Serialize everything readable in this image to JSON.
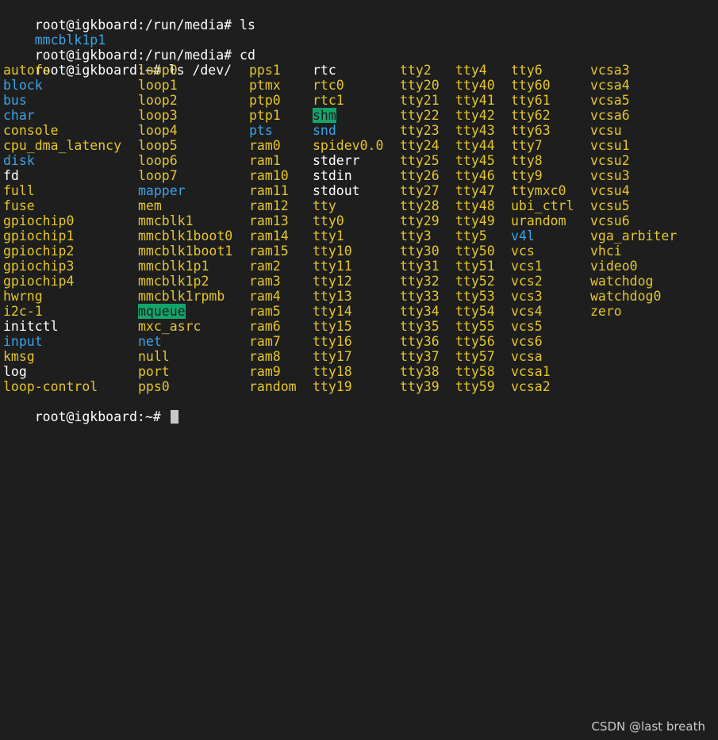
{
  "terminal": {
    "history": [
      {
        "prompt": "root@igkboard:/run/media# ",
        "command": "ls"
      }
    ],
    "media_listing": "mmcblk1p1",
    "history2": [
      {
        "prompt": "root@igkboard:/run/media# ",
        "command": "cd"
      },
      {
        "prompt": "root@igkboard:~# ",
        "command": "ls /dev/"
      }
    ],
    "columns": [
      [
        {
          "t": "autofs",
          "k": "dev"
        },
        {
          "t": "block",
          "k": "dir"
        },
        {
          "t": "bus",
          "k": "dir"
        },
        {
          "t": "char",
          "k": "dir"
        },
        {
          "t": "console",
          "k": "dev"
        },
        {
          "t": "cpu_dma_latency",
          "k": "dev"
        },
        {
          "t": "disk",
          "k": "dir"
        },
        {
          "t": "fd",
          "k": "link"
        },
        {
          "t": "full",
          "k": "dev"
        },
        {
          "t": "fuse",
          "k": "dev"
        },
        {
          "t": "gpiochip0",
          "k": "dev"
        },
        {
          "t": "gpiochip1",
          "k": "dev"
        },
        {
          "t": "gpiochip2",
          "k": "dev"
        },
        {
          "t": "gpiochip3",
          "k": "dev"
        },
        {
          "t": "gpiochip4",
          "k": "dev"
        },
        {
          "t": "hwrng",
          "k": "dev"
        },
        {
          "t": "i2c-1",
          "k": "dev"
        },
        {
          "t": "initctl",
          "k": "link"
        },
        {
          "t": "input",
          "k": "dir"
        },
        {
          "t": "kmsg",
          "k": "dev"
        },
        {
          "t": "log",
          "k": "link"
        },
        {
          "t": "loop-control",
          "k": "dev"
        }
      ],
      [
        {
          "t": "loop0",
          "k": "dev"
        },
        {
          "t": "loop1",
          "k": "dev"
        },
        {
          "t": "loop2",
          "k": "dev"
        },
        {
          "t": "loop3",
          "k": "dev"
        },
        {
          "t": "loop4",
          "k": "dev"
        },
        {
          "t": "loop5",
          "k": "dev"
        },
        {
          "t": "loop6",
          "k": "dev"
        },
        {
          "t": "loop7",
          "k": "dev"
        },
        {
          "t": "mapper",
          "k": "dir"
        },
        {
          "t": "mem",
          "k": "dev"
        },
        {
          "t": "mmcblk1",
          "k": "dev"
        },
        {
          "t": "mmcblk1boot0",
          "k": "dev"
        },
        {
          "t": "mmcblk1boot1",
          "k": "dev"
        },
        {
          "t": "mmcblk1p1",
          "k": "dev"
        },
        {
          "t": "mmcblk1p2",
          "k": "dev"
        },
        {
          "t": "mmcblk1rpmb",
          "k": "dev"
        },
        {
          "t": "mqueue",
          "k": "sticky"
        },
        {
          "t": "mxc_asrc",
          "k": "dev"
        },
        {
          "t": "net",
          "k": "dir"
        },
        {
          "t": "null",
          "k": "dev"
        },
        {
          "t": "port",
          "k": "dev"
        },
        {
          "t": "pps0",
          "k": "dev"
        }
      ],
      [
        {
          "t": "pps1",
          "k": "dev"
        },
        {
          "t": "ptmx",
          "k": "dev"
        },
        {
          "t": "ptp0",
          "k": "dev"
        },
        {
          "t": "ptp1",
          "k": "dev"
        },
        {
          "t": "pts",
          "k": "dir"
        },
        {
          "t": "ram0",
          "k": "dev"
        },
        {
          "t": "ram1",
          "k": "dev"
        },
        {
          "t": "ram10",
          "k": "dev"
        },
        {
          "t": "ram11",
          "k": "dev"
        },
        {
          "t": "ram12",
          "k": "dev"
        },
        {
          "t": "ram13",
          "k": "dev"
        },
        {
          "t": "ram14",
          "k": "dev"
        },
        {
          "t": "ram15",
          "k": "dev"
        },
        {
          "t": "ram2",
          "k": "dev"
        },
        {
          "t": "ram3",
          "k": "dev"
        },
        {
          "t": "ram4",
          "k": "dev"
        },
        {
          "t": "ram5",
          "k": "dev"
        },
        {
          "t": "ram6",
          "k": "dev"
        },
        {
          "t": "ram7",
          "k": "dev"
        },
        {
          "t": "ram8",
          "k": "dev"
        },
        {
          "t": "ram9",
          "k": "dev"
        },
        {
          "t": "random",
          "k": "dev"
        }
      ],
      [
        {
          "t": "rtc",
          "k": "link"
        },
        {
          "t": "rtc0",
          "k": "dev"
        },
        {
          "t": "rtc1",
          "k": "dev"
        },
        {
          "t": "shm",
          "k": "sticky"
        },
        {
          "t": "snd",
          "k": "dir"
        },
        {
          "t": "spidev0.0",
          "k": "dev"
        },
        {
          "t": "stderr",
          "k": "link"
        },
        {
          "t": "stdin",
          "k": "link"
        },
        {
          "t": "stdout",
          "k": "link"
        },
        {
          "t": "tty",
          "k": "dev"
        },
        {
          "t": "tty0",
          "k": "dev"
        },
        {
          "t": "tty1",
          "k": "dev"
        },
        {
          "t": "tty10",
          "k": "dev"
        },
        {
          "t": "tty11",
          "k": "dev"
        },
        {
          "t": "tty12",
          "k": "dev"
        },
        {
          "t": "tty13",
          "k": "dev"
        },
        {
          "t": "tty14",
          "k": "dev"
        },
        {
          "t": "tty15",
          "k": "dev"
        },
        {
          "t": "tty16",
          "k": "dev"
        },
        {
          "t": "tty17",
          "k": "dev"
        },
        {
          "t": "tty18",
          "k": "dev"
        },
        {
          "t": "tty19",
          "k": "dev"
        }
      ],
      [
        {
          "t": "tty2",
          "k": "dev"
        },
        {
          "t": "tty20",
          "k": "dev"
        },
        {
          "t": "tty21",
          "k": "dev"
        },
        {
          "t": "tty22",
          "k": "dev"
        },
        {
          "t": "tty23",
          "k": "dev"
        },
        {
          "t": "tty24",
          "k": "dev"
        },
        {
          "t": "tty25",
          "k": "dev"
        },
        {
          "t": "tty26",
          "k": "dev"
        },
        {
          "t": "tty27",
          "k": "dev"
        },
        {
          "t": "tty28",
          "k": "dev"
        },
        {
          "t": "tty29",
          "k": "dev"
        },
        {
          "t": "tty3",
          "k": "dev"
        },
        {
          "t": "tty30",
          "k": "dev"
        },
        {
          "t": "tty31",
          "k": "dev"
        },
        {
          "t": "tty32",
          "k": "dev"
        },
        {
          "t": "tty33",
          "k": "dev"
        },
        {
          "t": "tty34",
          "k": "dev"
        },
        {
          "t": "tty35",
          "k": "dev"
        },
        {
          "t": "tty36",
          "k": "dev"
        },
        {
          "t": "tty37",
          "k": "dev"
        },
        {
          "t": "tty38",
          "k": "dev"
        },
        {
          "t": "tty39",
          "k": "dev"
        }
      ],
      [
        {
          "t": "tty4",
          "k": "dev"
        },
        {
          "t": "tty40",
          "k": "dev"
        },
        {
          "t": "tty41",
          "k": "dev"
        },
        {
          "t": "tty42",
          "k": "dev"
        },
        {
          "t": "tty43",
          "k": "dev"
        },
        {
          "t": "tty44",
          "k": "dev"
        },
        {
          "t": "tty45",
          "k": "dev"
        },
        {
          "t": "tty46",
          "k": "dev"
        },
        {
          "t": "tty47",
          "k": "dev"
        },
        {
          "t": "tty48",
          "k": "dev"
        },
        {
          "t": "tty49",
          "k": "dev"
        },
        {
          "t": "tty5",
          "k": "dev"
        },
        {
          "t": "tty50",
          "k": "dev"
        },
        {
          "t": "tty51",
          "k": "dev"
        },
        {
          "t": "tty52",
          "k": "dev"
        },
        {
          "t": "tty53",
          "k": "dev"
        },
        {
          "t": "tty54",
          "k": "dev"
        },
        {
          "t": "tty55",
          "k": "dev"
        },
        {
          "t": "tty56",
          "k": "dev"
        },
        {
          "t": "tty57",
          "k": "dev"
        },
        {
          "t": "tty58",
          "k": "dev"
        },
        {
          "t": "tty59",
          "k": "dev"
        }
      ],
      [
        {
          "t": "tty6",
          "k": "dev"
        },
        {
          "t": "tty60",
          "k": "dev"
        },
        {
          "t": "tty61",
          "k": "dev"
        },
        {
          "t": "tty62",
          "k": "dev"
        },
        {
          "t": "tty63",
          "k": "dev"
        },
        {
          "t": "tty7",
          "k": "dev"
        },
        {
          "t": "tty8",
          "k": "dev"
        },
        {
          "t": "tty9",
          "k": "dev"
        },
        {
          "t": "ttymxc0",
          "k": "dev"
        },
        {
          "t": "ubi_ctrl",
          "k": "dev"
        },
        {
          "t": "urandom",
          "k": "dev"
        },
        {
          "t": "v4l",
          "k": "dir"
        },
        {
          "t": "vcs",
          "k": "dev"
        },
        {
          "t": "vcs1",
          "k": "dev"
        },
        {
          "t": "vcs2",
          "k": "dev"
        },
        {
          "t": "vcs3",
          "k": "dev"
        },
        {
          "t": "vcs4",
          "k": "dev"
        },
        {
          "t": "vcs5",
          "k": "dev"
        },
        {
          "t": "vcs6",
          "k": "dev"
        },
        {
          "t": "vcsa",
          "k": "dev"
        },
        {
          "t": "vcsa1",
          "k": "dev"
        },
        {
          "t": "vcsa2",
          "k": "dev"
        }
      ],
      [
        {
          "t": "vcsa3",
          "k": "dev"
        },
        {
          "t": "vcsa4",
          "k": "dev"
        },
        {
          "t": "vcsa5",
          "k": "dev"
        },
        {
          "t": "vcsa6",
          "k": "dev"
        },
        {
          "t": "vcsu",
          "k": "dev"
        },
        {
          "t": "vcsu1",
          "k": "dev"
        },
        {
          "t": "vcsu2",
          "k": "dev"
        },
        {
          "t": "vcsu3",
          "k": "dev"
        },
        {
          "t": "vcsu4",
          "k": "dev"
        },
        {
          "t": "vcsu5",
          "k": "dev"
        },
        {
          "t": "vcsu6",
          "k": "dev"
        },
        {
          "t": "vga_arbiter",
          "k": "dev"
        },
        {
          "t": "vhci",
          "k": "dev"
        },
        {
          "t": "video0",
          "k": "dev"
        },
        {
          "t": "watchdog",
          "k": "dev"
        },
        {
          "t": "watchdog0",
          "k": "dev"
        },
        {
          "t": "zero",
          "k": "dev"
        }
      ]
    ],
    "final_prompt": "root@igkboard:~# "
  },
  "colors": {
    "background": "#1e1e1e",
    "device": "#e5c62a",
    "directory": "#3ba4e4",
    "symlink": "#7ad2e8",
    "sticky_bg": "#13a46b"
  },
  "watermark": "CSDN @last breath"
}
